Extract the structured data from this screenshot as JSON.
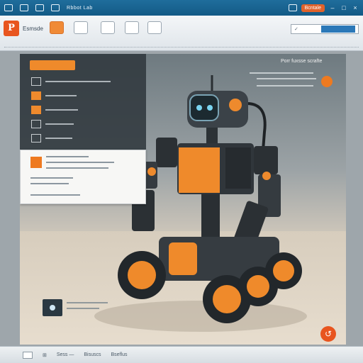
{
  "titlebar": {
    "wordmark": "Rbbot Lab",
    "pill": "Bcntale"
  },
  "ribbon": {
    "appname": "Esmsde",
    "logo_letter": "P",
    "searchbox_text": "✓"
  },
  "panel": {
    "right_label": "Porr fuxsse scrafte"
  },
  "fab_icon": "↺",
  "status": {
    "items": [
      "⊞",
      "Sess —",
      "Bisuscs",
      "Bseflus"
    ]
  },
  "colors": {
    "accent": "#ee7a20",
    "titlebar": "#1f6d9c",
    "panel": "#30383e"
  }
}
